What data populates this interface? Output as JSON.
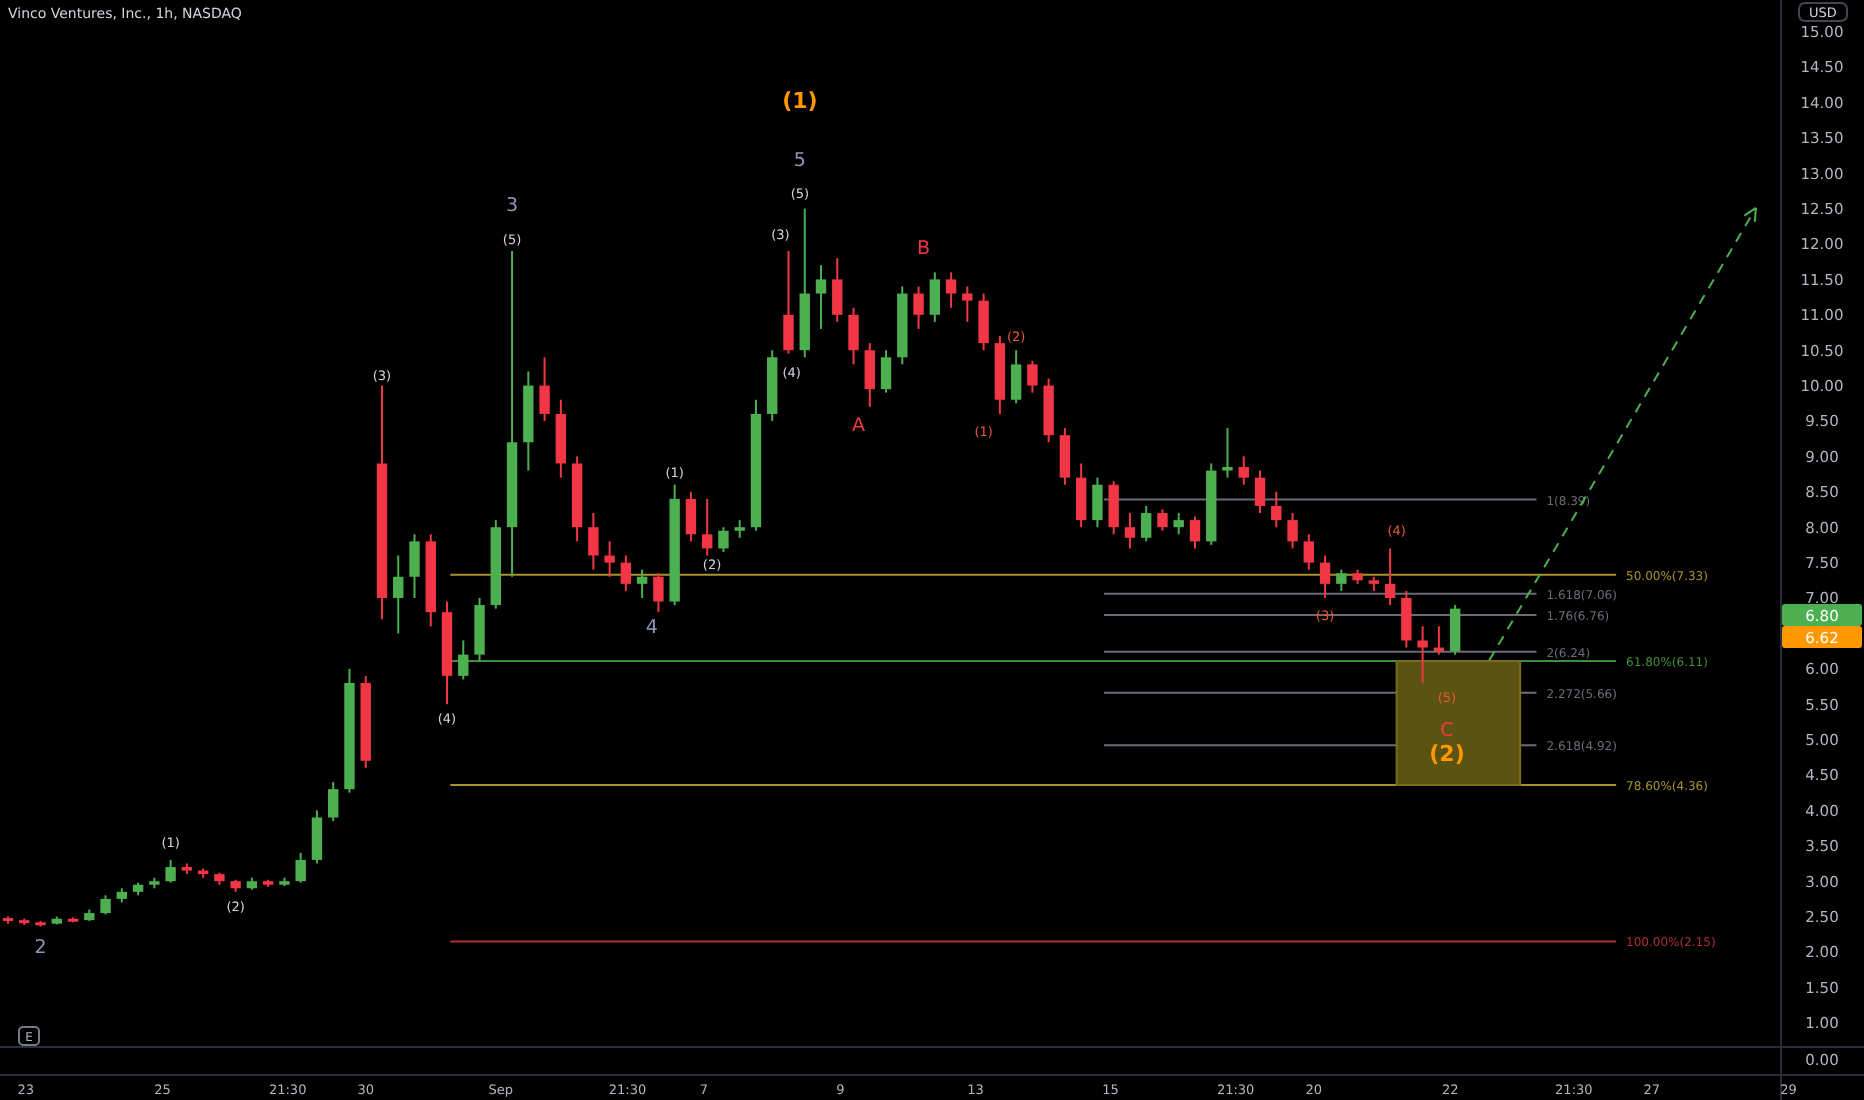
{
  "chart": {
    "title": "Vinco Ventures, Inc., 1h, NASDAQ",
    "currency": "USD",
    "price_axis": [
      "15.00",
      "14.50",
      "14.00",
      "13.50",
      "13.00",
      "12.50",
      "12.00",
      "11.50",
      "11.00",
      "10.50",
      "10.00",
      "9.50",
      "9.00",
      "8.50",
      "8.00",
      "7.50",
      "7.00",
      "6.00",
      "5.50",
      "5.00",
      "4.50",
      "4.00",
      "3.50",
      "3.00",
      "2.50",
      "2.00",
      "1.50",
      "1.00"
    ],
    "time_axis": [
      "23",
      "25",
      "21:30",
      "30",
      "Sep",
      "21:30",
      "7",
      "9",
      "13",
      "15",
      "21:30",
      "20",
      "22",
      "21:30",
      "27",
      "29"
    ],
    "events_pane": {
      "tick_label": "0.00",
      "markers": [
        {
          "label": "E"
        }
      ]
    },
    "price_labels": [
      {
        "text": "6.80",
        "color": "#4caf50"
      },
      {
        "text": "6.62",
        "color": "#ff9800"
      }
    ],
    "fib_levels": [
      {
        "label": "1(8.39)",
        "color": "#6a6d78"
      },
      {
        "label": "50.00%(7.33)",
        "color": "#a8922a"
      },
      {
        "label": "1.618(7.06)",
        "color": "#6a6d78"
      },
      {
        "label": "1.76(6.76)",
        "color": "#6a6d78"
      },
      {
        "label": "2(6.24)",
        "color": "#6a6d78"
      },
      {
        "label": "61.80%(6.11)",
        "color": "#3f8f3a"
      },
      {
        "label": "2.272(5.66)",
        "color": "#6a6d78"
      },
      {
        "label": "2.618(4.92)",
        "color": "#6a6d78"
      },
      {
        "label": "78.60%(4.36)",
        "color": "#a8922a"
      },
      {
        "label": "100.00%(2.15)",
        "color": "#a83232"
      }
    ],
    "wave_labels": [
      {
        "text": "2",
        "color": "#8f98b8"
      },
      {
        "text": "(1)",
        "color": "#d1d4dc"
      },
      {
        "text": "(2)",
        "color": "#d1d4dc"
      },
      {
        "text": "(3)",
        "color": "#d1d4dc"
      },
      {
        "text": "(4)",
        "color": "#d1d4dc"
      },
      {
        "text": "3",
        "color": "#8f98b8"
      },
      {
        "text": "(5)",
        "color": "#d1d4dc"
      },
      {
        "text": "4",
        "color": "#8f98b8"
      },
      {
        "text": "(1)",
        "color": "#d1d4dc"
      },
      {
        "text": "(2)",
        "color": "#d1d4dc"
      },
      {
        "text": "(1)",
        "color": "#ff9800"
      },
      {
        "text": "5",
        "color": "#8f98b8"
      },
      {
        "text": "(5)",
        "color": "#d1d4dc"
      },
      {
        "text": "(3)",
        "color": "#d1d4dc"
      },
      {
        "text": "(4)",
        "color": "#d1d4dc"
      },
      {
        "text": "A",
        "color": "#f23645"
      },
      {
        "text": "B",
        "color": "#f23645"
      },
      {
        "text": "(1)",
        "color": "#e8572e"
      },
      {
        "text": "(2)",
        "color": "#e8572e"
      },
      {
        "text": "(3)",
        "color": "#e8572e"
      },
      {
        "text": "(4)",
        "color": "#e8572e"
      },
      {
        "text": "(5)",
        "color": "#e8572e"
      },
      {
        "text": "C",
        "color": "#f23645"
      },
      {
        "text": "(2)",
        "color": "#ff9800"
      }
    ]
  }
}
